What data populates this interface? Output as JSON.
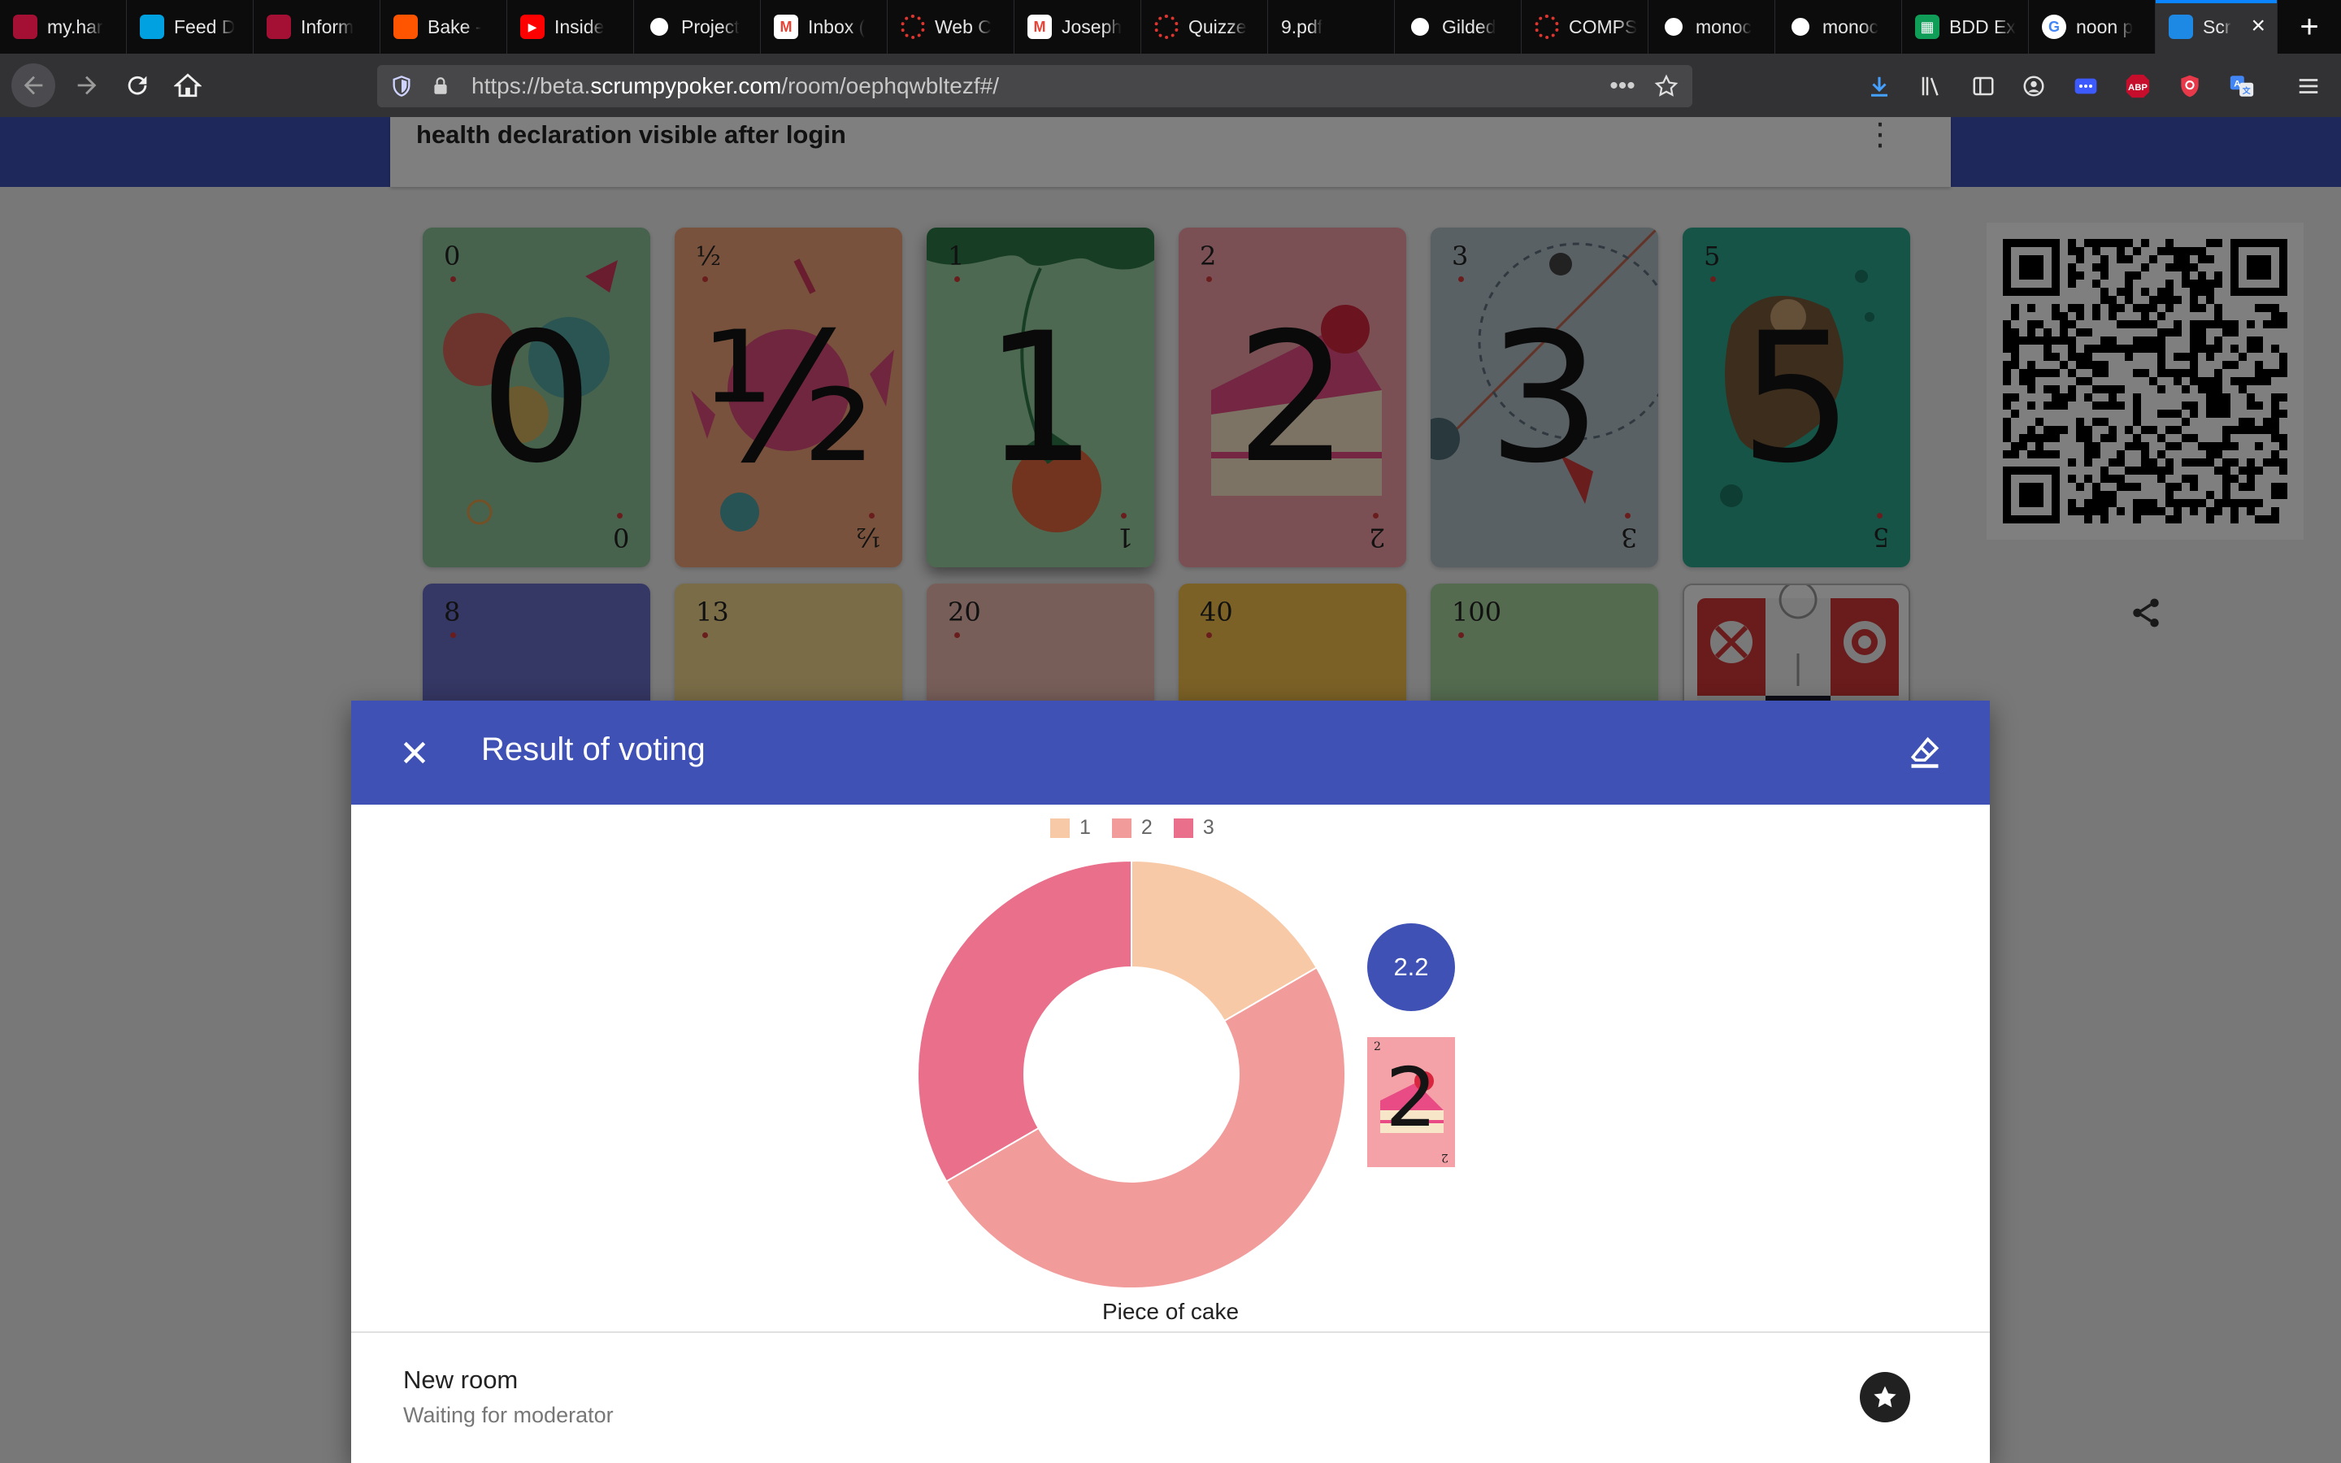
{
  "browser": {
    "tabs": [
      {
        "label": "my.har",
        "icon": "shield-icon",
        "color": "#a41034"
      },
      {
        "label": "Feed D",
        "icon": "salesforce-cloud-icon",
        "color": "#00a1e0"
      },
      {
        "label": "Inform",
        "icon": "shield-icon",
        "color": "#a41034"
      },
      {
        "label": "Bake -",
        "icon": "soundcloud-icon",
        "color": "#ff5500"
      },
      {
        "label": "Inside",
        "icon": "youtube-icon",
        "color": "#ff0000"
      },
      {
        "label": "Project",
        "icon": "github-icon",
        "color": "#ffffff"
      },
      {
        "label": "Inbox (",
        "icon": "gmail-icon",
        "color": "#ea4335"
      },
      {
        "label": "Web C",
        "icon": "ring-logo-icon",
        "color": "#e0352f"
      },
      {
        "label": "Joseph",
        "icon": "gmail-icon",
        "color": "#ea4335"
      },
      {
        "label": "Quizze",
        "icon": "ring-logo-icon",
        "color": "#e0352f"
      },
      {
        "label": "9.pdf",
        "icon": "",
        "color": ""
      },
      {
        "label": "Gilded",
        "icon": "github-icon",
        "color": "#ffffff"
      },
      {
        "label": "COMPS",
        "icon": "ring-logo-icon",
        "color": "#e0352f"
      },
      {
        "label": "monoc",
        "icon": "github-icon",
        "color": "#ffffff"
      },
      {
        "label": "monoc",
        "icon": "github-icon",
        "color": "#ffffff"
      },
      {
        "label": "BDD Ex",
        "icon": "sheets-icon",
        "color": "#0f9d58"
      },
      {
        "label": "noon p",
        "icon": "google-icon",
        "color": "#4285f4"
      },
      {
        "label": "Scr",
        "icon": "scrumpy-icon",
        "color": "#1e88e5",
        "active": true
      }
    ],
    "url_prefix": "https://beta.",
    "url_host": "scrumpypoker.com",
    "url_path": "/room/oephqwbltezf#/"
  },
  "room": {
    "title": "health declaration visible after login"
  },
  "cards": [
    {
      "value": "0",
      "bg": "#8fc79a"
    },
    {
      "value": "½",
      "bg": "#f0a47a"
    },
    {
      "value": "1",
      "bg": "#9dd3a3"
    },
    {
      "value": "2",
      "bg": "#f4a1a8"
    },
    {
      "value": "3",
      "bg": "#b5c2c9"
    },
    {
      "value": "5",
      "bg": "#2aa98f"
    },
    {
      "value": "8",
      "bg": "#6b6fc9"
    },
    {
      "value": "13",
      "bg": "#f2d88f"
    },
    {
      "value": "20",
      "bg": "#eebcb3"
    },
    {
      "value": "40",
      "bg": "#f6c24c"
    },
    {
      "value": "100",
      "bg": "#a8d7a0"
    }
  ],
  "dialog": {
    "title": "Result of voting",
    "average": "2.2",
    "mini_card_value": "2",
    "chart_caption": "Piece of cake",
    "room_name": "New room",
    "room_status": "Waiting for moderator"
  },
  "chart_data": {
    "type": "pie",
    "categories": [
      "1",
      "2",
      "3"
    ],
    "values": [
      1,
      3,
      2
    ],
    "colors": [
      "#f8c9a6",
      "#f29b9b",
      "#ea6f8b"
    ],
    "donut": true,
    "legend": "top"
  }
}
